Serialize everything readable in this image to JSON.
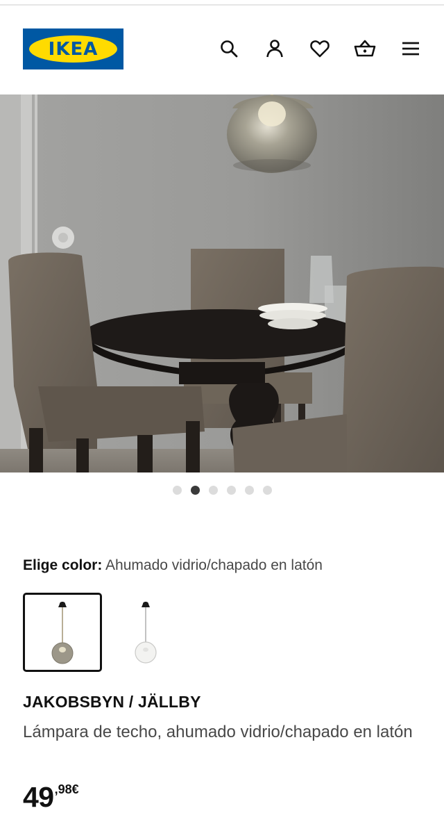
{
  "header": {
    "logo_text": "IKEA",
    "icons": [
      "search-icon",
      "user-icon",
      "heart-icon",
      "shopping-basket-icon",
      "menu-icon"
    ]
  },
  "hero": {
    "carousel_total": 6,
    "carousel_active_index": 1
  },
  "color_picker": {
    "label": "Elige color:",
    "selected_value": "Ahumado vidrio/chapado en latón",
    "options": [
      {
        "name": "smoked-glass-pendant",
        "selected": true
      },
      {
        "name": "clear-glass-pendant",
        "selected": false
      }
    ]
  },
  "product": {
    "name": "JAKOBSBYN / JÄLLBY",
    "description": "Lámpara de techo, ahumado vidrio/chapado en latón",
    "price_integer": "49",
    "price_decimal": ",98€"
  },
  "colors": {
    "ikea_blue": "#0058a3",
    "ikea_yellow": "#ffdb00",
    "text_primary": "#111111",
    "text_secondary": "#484848"
  }
}
